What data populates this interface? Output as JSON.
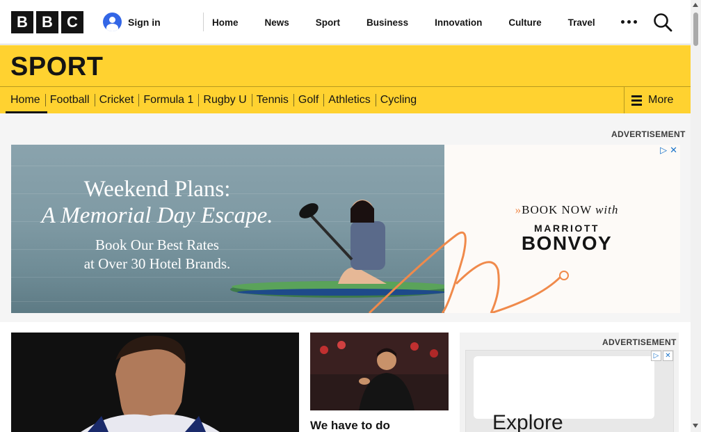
{
  "header": {
    "logo": [
      "B",
      "B",
      "C"
    ],
    "sign_in": "Sign in",
    "nav": [
      "Home",
      "News",
      "Sport",
      "Business",
      "Innovation",
      "Culture",
      "Travel"
    ],
    "icons": {
      "more": "more-dots-icon",
      "search": "search-icon",
      "account": "user-icon"
    }
  },
  "section": {
    "title": "SPORT"
  },
  "subnav": {
    "items": [
      "Home",
      "Football",
      "Cricket",
      "Formula 1",
      "Rugby U",
      "Tennis",
      "Golf",
      "Athletics",
      "Cycling"
    ],
    "active": "Home",
    "more_label": "More"
  },
  "ad_top": {
    "label": "ADVERTISEMENT",
    "headline_1": "Weekend Plans:",
    "headline_2": "A Memorial Day Escape.",
    "body_1": "Book Our Best Rates",
    "body_2": "at Over 30 Hotel Brands.",
    "cta_prefix": "»",
    "cta": "BOOK NOW",
    "cta_suffix": "with",
    "brand_1": "MARRIOTT",
    "brand_2": "BONVOY",
    "accent_color": "#f08a4b"
  },
  "content": {
    "card2_title": "We have to do"
  },
  "ad_side": {
    "label": "ADVERTISEMENT",
    "text": "Explore"
  },
  "colors": {
    "sport_yellow": "#ffd230",
    "text_dark": "#141414",
    "account_blue": "#3366e6"
  }
}
